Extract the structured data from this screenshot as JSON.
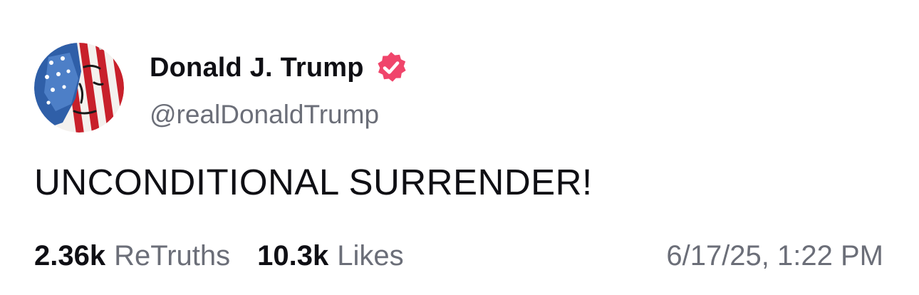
{
  "author": {
    "display_name": "Donald J. Trump",
    "handle": "@realDonaldTrump",
    "verified": true,
    "verified_badge_icon": "verified-badge-icon",
    "verified_badge_color": "#f0456b"
  },
  "post": {
    "text": "UNCONDITIONAL SURRENDER!"
  },
  "stats": {
    "retruths_count": "2.36k",
    "retruths_label": "ReTruths",
    "likes_count": "10.3k",
    "likes_label": "Likes"
  },
  "timestamp": "6/17/25, 1:22 PM",
  "colors": {
    "text_primary": "#0f0f14",
    "text_secondary": "#6b6e78",
    "background": "#ffffff"
  }
}
